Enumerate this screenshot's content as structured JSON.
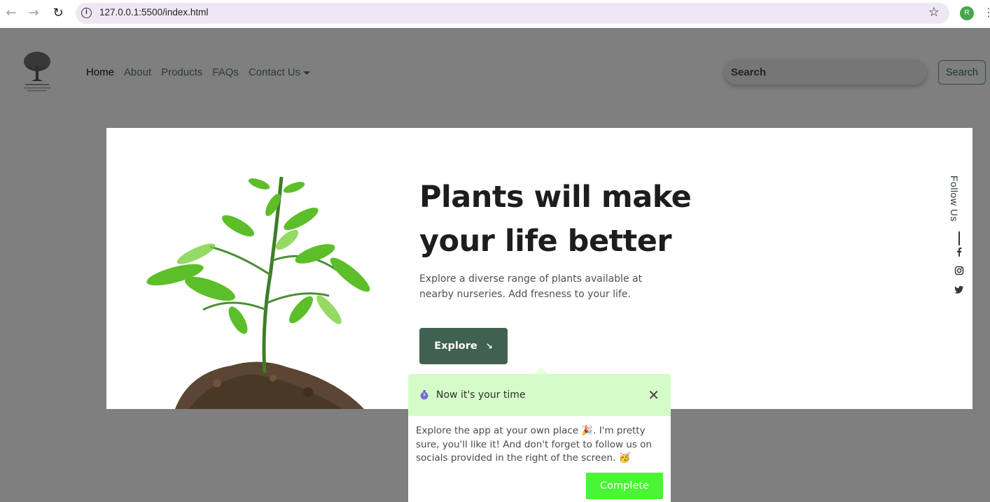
{
  "browser": {
    "url": "127.0.0.1:5500/index.html",
    "profile_initial": "R",
    "icons": [
      "back-arrow-icon",
      "forward-arrow-icon",
      "reload-icon",
      "site-info-icon",
      "bookmark-star-icon",
      "more-vert-icon"
    ]
  },
  "navbar": {
    "items": [
      {
        "label": "Home"
      },
      {
        "label": "About"
      },
      {
        "label": "Products"
      },
      {
        "label": "FAQs"
      },
      {
        "label": "Contact Us"
      }
    ],
    "search_placeholder": "Search",
    "search_button": "Search"
  },
  "hero": {
    "headline": "Plants will make your life better",
    "subtext": "Explore a diverse range of plants available at nearby nurseries. Add fresness to your life.",
    "explore_label": "Explore",
    "follow_label": "Follow Us",
    "social_icons": [
      "facebook-icon",
      "instagram-icon",
      "twitter-icon"
    ]
  },
  "tour": {
    "title": "Now it's your time",
    "body": "Explore the app at your own place 🎉. I'm pretty sure, you'll like it! And don't forget to follow us on socials provided in the right of the screen. 🥳",
    "complete_label": "Complete"
  },
  "colors": {
    "overlay": "#7f7f7f",
    "primary_green": "#416150",
    "popover_header": "#d5fbc8",
    "complete_button": "#49f534"
  }
}
